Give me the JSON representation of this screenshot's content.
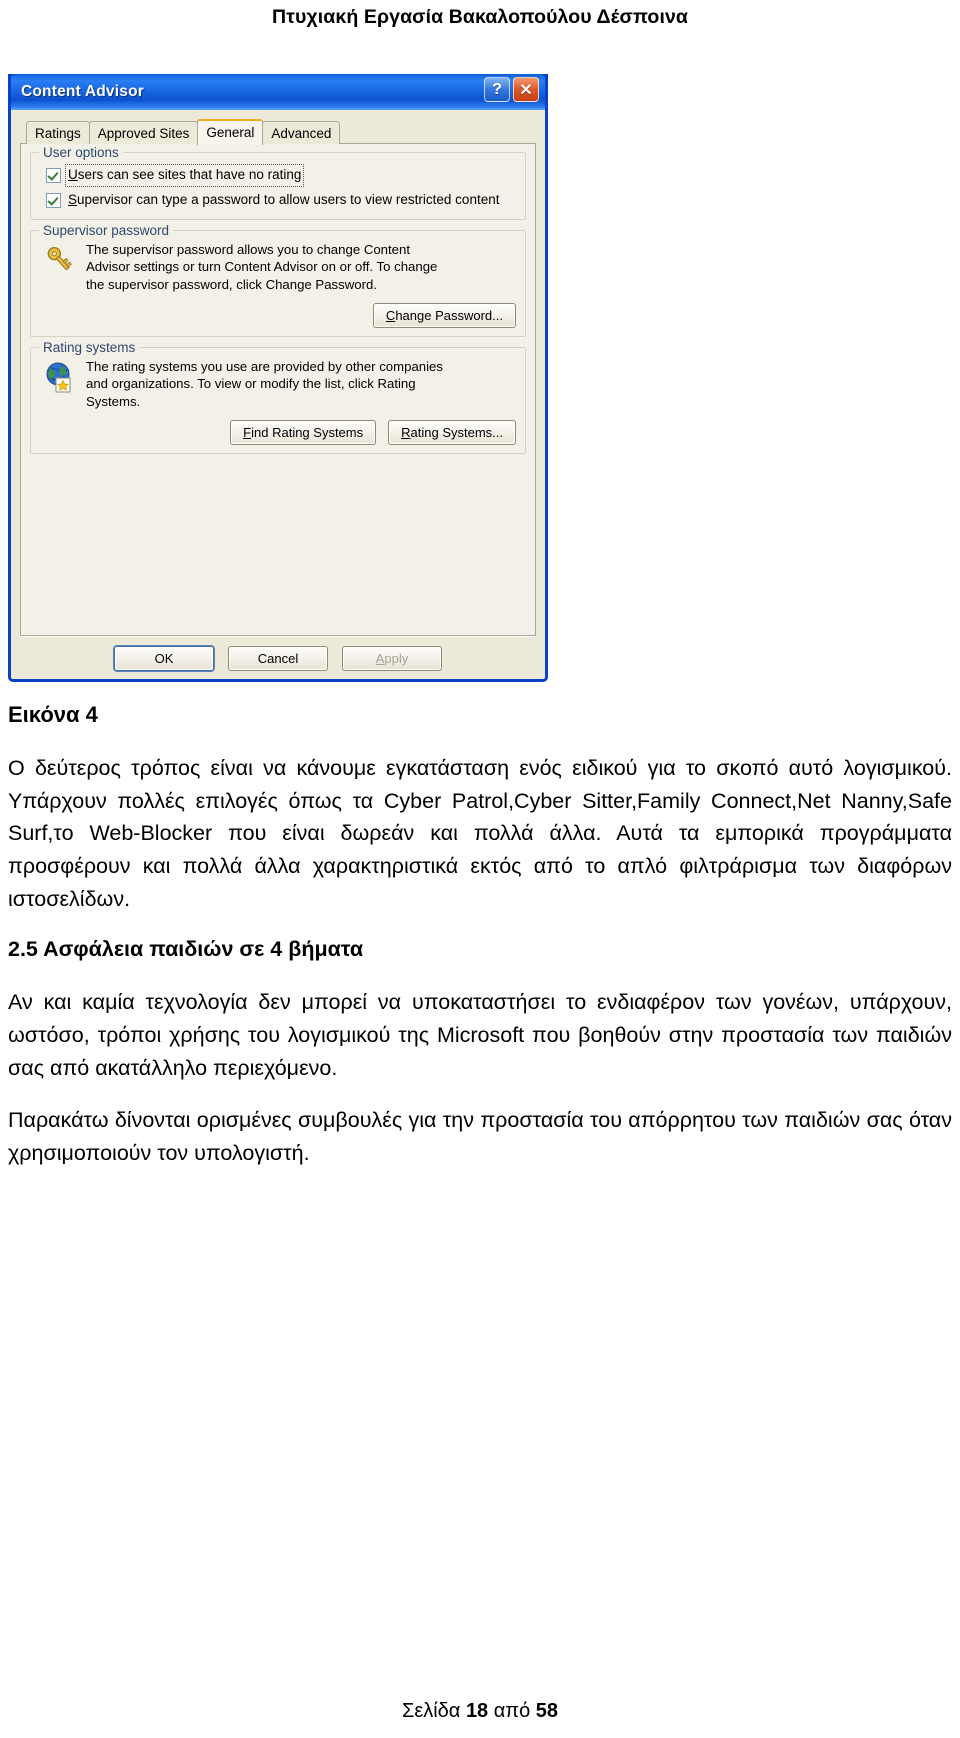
{
  "document": {
    "header": "Πτυχιακή Εργασία Βακαλοπούλου Δέσποινα",
    "figure_caption": "Εικόνα 4",
    "paragraphs": [
      "Ο δεύτερος τρόπος είναι να κάνουμε εγκατάσταση ενός ειδικού για το σκοπό αυτό λογισμικού. Υπάρχουν πολλές επιλογές όπως τα Cyber Patrol,Cyber Sitter,Family Connect,Net Nanny,Safe Surf,το Web-Blocker που είναι δωρεάν και πολλά άλλα. Αυτά τα εμπορικά προγράμματα προσφέρουν και πολλά άλλα χαρακτηριστικά εκτός από το απλό φιλτράρισμα των διαφόρων ιστοσελίδων.",
      "Αν και καμία τεχνολογία δεν μπορεί να υποκαταστήσει το ενδιαφέρον των γονέων, υπάρχουν, ωστόσο, τρόποι χρήσης του λογισμικού της Microsoft που βοηθούν στην προστασία των παιδιών σας από ακατάλληλο περιεχόμενο.",
      "Παρακάτω δίνονται ορισμένες συμβουλές για την προστασία του απόρρητου των παιδιών σας όταν χρησιμοποιούν τον υπολογιστή."
    ],
    "section_heading": "2.5 Ασφάλεια παιδιών σε 4 βήματα",
    "footer": {
      "prefix": "Σελίδα ",
      "page": "18",
      "middle": " από ",
      "total": "58"
    }
  },
  "dialog": {
    "title": "Content Advisor",
    "titlebar_buttons": {
      "help": "?",
      "close": "✕"
    },
    "tabs": [
      {
        "label": "Ratings",
        "active": false
      },
      {
        "label": "Approved Sites",
        "active": false
      },
      {
        "label": "General",
        "active": true
      },
      {
        "label": "Advanced",
        "active": false
      }
    ],
    "groups": {
      "user_options": {
        "title": "User options",
        "checkboxes": [
          {
            "label_accel": "U",
            "label_rest": "sers can see sites that have no rating",
            "checked": true,
            "focused": true
          },
          {
            "label_accel": "S",
            "label_rest": "upervisor can type a password to allow users to view restricted content",
            "checked": true,
            "focused": false
          }
        ]
      },
      "supervisor_password": {
        "title": "Supervisor password",
        "icon": "key-icon",
        "description": "The supervisor password allows you to change Content Advisor settings or turn Content Advisor on or off. To change the supervisor password, click Change Password.",
        "button": {
          "accel": "C",
          "rest": "hange Password..."
        }
      },
      "rating_systems": {
        "title": "Rating systems",
        "icon": "globe-star-icon",
        "description": "The rating systems you use are provided by other companies and organizations. To view or modify the list, click Rating Systems.",
        "buttons": [
          {
            "accel": "F",
            "rest": "ind Rating Systems"
          },
          {
            "accel": "R",
            "rest": "ating Systems..."
          }
        ]
      }
    },
    "footer_buttons": [
      {
        "label": "OK",
        "default": true,
        "disabled": false
      },
      {
        "label": "Cancel",
        "default": false,
        "disabled": false
      },
      {
        "accel": "A",
        "rest": "pply",
        "default": false,
        "disabled": true
      }
    ],
    "colors": {
      "titlebar": "#1d6fe8",
      "border": "#0a41c8",
      "face": "#ece9d8",
      "panel": "#f3f1e7",
      "group_title": "#2c4a6e",
      "active_tab_accent": "#f2a922"
    }
  }
}
